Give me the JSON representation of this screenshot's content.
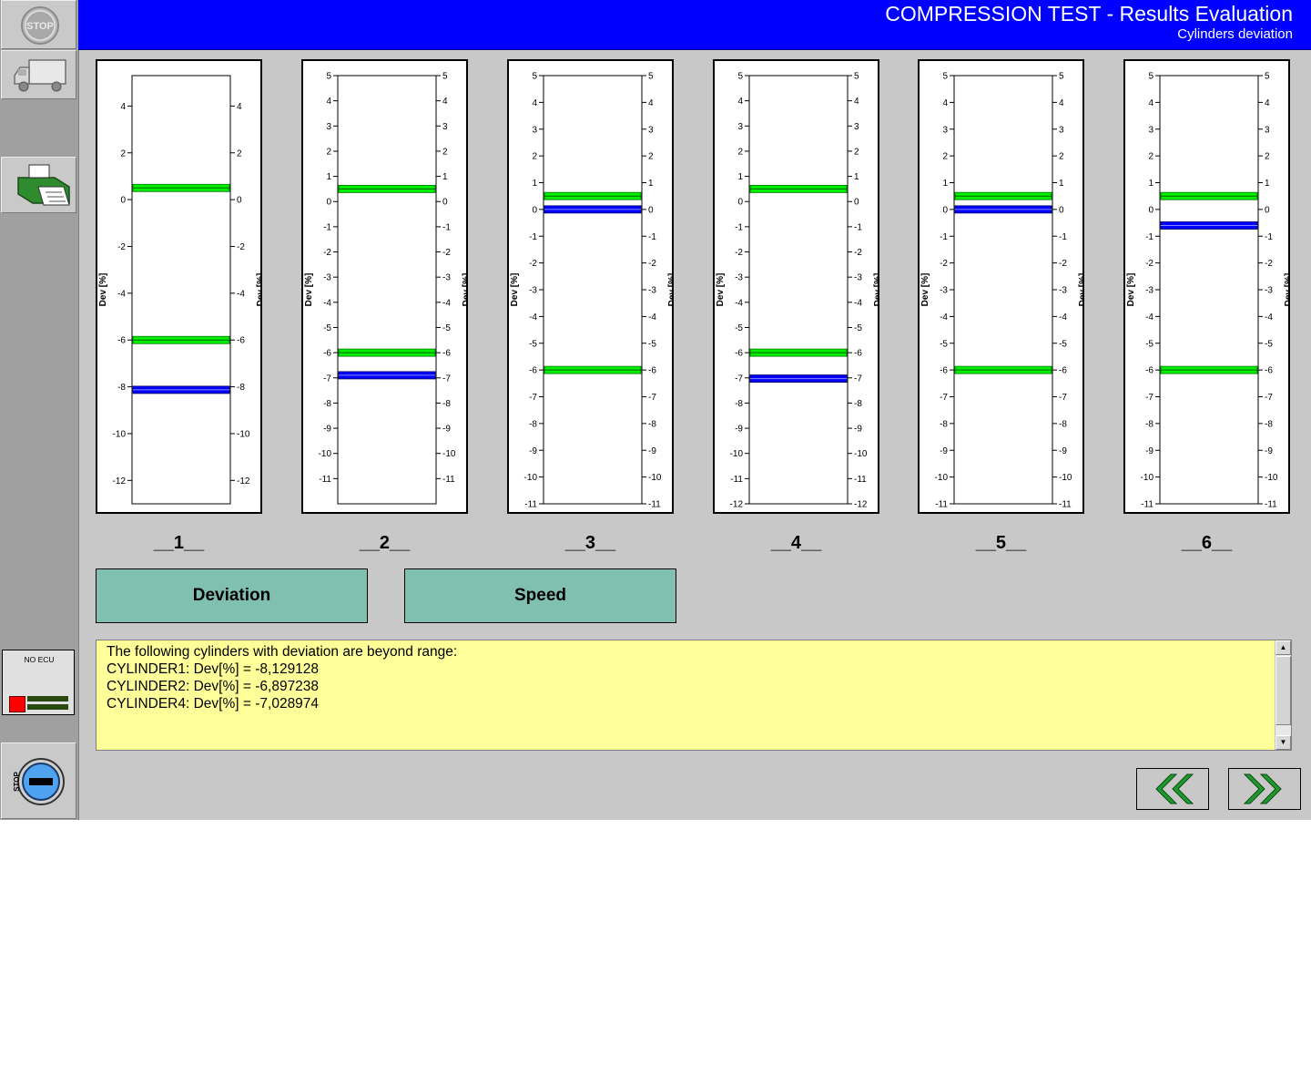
{
  "header": {
    "title": "COMPRESSION TEST - Results Evaluation",
    "subtitle": "Cylinders deviation"
  },
  "sidebar": {
    "stop_button_label": "STOP",
    "stop_button_icon": "stop-sign-icon",
    "vehicle_icon": "truck-icon",
    "print_icon": "printer-icon",
    "ecu_status": "NO ECU",
    "ecu_status_color": "#ff0000",
    "exit_label": "STOP",
    "exit_icon": "exit-stop-icon"
  },
  "charts": {
    "axis_label": "Dev [%]",
    "band_color": "#00ee00",
    "value_color": "#0000ff"
  },
  "chart_data": [
    {
      "type": "bar",
      "title": "__1__",
      "ylabel": "Dev [%]",
      "ylim": [
        -13,
        5.3
      ],
      "ticks": [
        4,
        2,
        0,
        -2,
        -4,
        -6,
        -8,
        -10,
        -12
      ],
      "bands": [
        0.5,
        -6
      ],
      "value": -8.129128
    },
    {
      "type": "bar",
      "title": "__2__",
      "ylabel": "Dev [%]",
      "ylim": [
        -12,
        5
      ],
      "ticks": [
        5,
        4,
        3,
        2,
        1,
        0,
        -1,
        -2,
        -3,
        -4,
        -5,
        -6,
        -7,
        -8,
        -9,
        -10,
        -11
      ],
      "bands": [
        0.5,
        -6
      ],
      "value": -6.897238
    },
    {
      "type": "bar",
      "title": "__3__",
      "ylabel": "Dev [%]",
      "ylim": [
        -11,
        5
      ],
      "ticks": [
        5,
        4,
        3,
        2,
        1,
        0,
        -1,
        -2,
        -3,
        -4,
        -5,
        -6,
        -7,
        -8,
        -9,
        -10,
        -11
      ],
      "bands": [
        0.5,
        -6
      ],
      "value": 0
    },
    {
      "type": "bar",
      "title": "__4__",
      "ylabel": "Dev [%]",
      "ylim": [
        -12,
        5
      ],
      "ticks": [
        5,
        4,
        3,
        2,
        1,
        0,
        -1,
        -2,
        -3,
        -4,
        -5,
        -6,
        -7,
        -8,
        -9,
        -10,
        -11,
        -12
      ],
      "bands": [
        0.5,
        -6
      ],
      "value": -7.028974
    },
    {
      "type": "bar",
      "title": "__5__",
      "ylabel": "Dev [%]",
      "ylim": [
        -11,
        5
      ],
      "ticks": [
        5,
        4,
        3,
        2,
        1,
        0,
        -1,
        -2,
        -3,
        -4,
        -5,
        -6,
        -7,
        -8,
        -9,
        -10,
        -11
      ],
      "bands": [
        0.5,
        -6
      ],
      "value": 0
    },
    {
      "type": "bar",
      "title": "__6__",
      "ylabel": "Dev [%]",
      "ylim": [
        -11,
        5
      ],
      "ticks": [
        5,
        4,
        3,
        2,
        1,
        0,
        -1,
        -2,
        -3,
        -4,
        -5,
        -6,
        -7,
        -8,
        -9,
        -10,
        -11
      ],
      "bands": [
        0.5,
        -6
      ],
      "value": -0.6
    }
  ],
  "buttons": {
    "deviation": "Deviation",
    "speed": "Speed",
    "back_icon": "double-chevron-left-icon",
    "next_icon": "double-chevron-right-icon"
  },
  "message": {
    "lines": [
      "The following cylinders with deviation are beyond range:",
      "CYLINDER1: Dev[%] = -8,129128",
      "CYLINDER2: Dev[%] = -6,897238",
      "CYLINDER4: Dev[%] = -7,028974"
    ]
  }
}
